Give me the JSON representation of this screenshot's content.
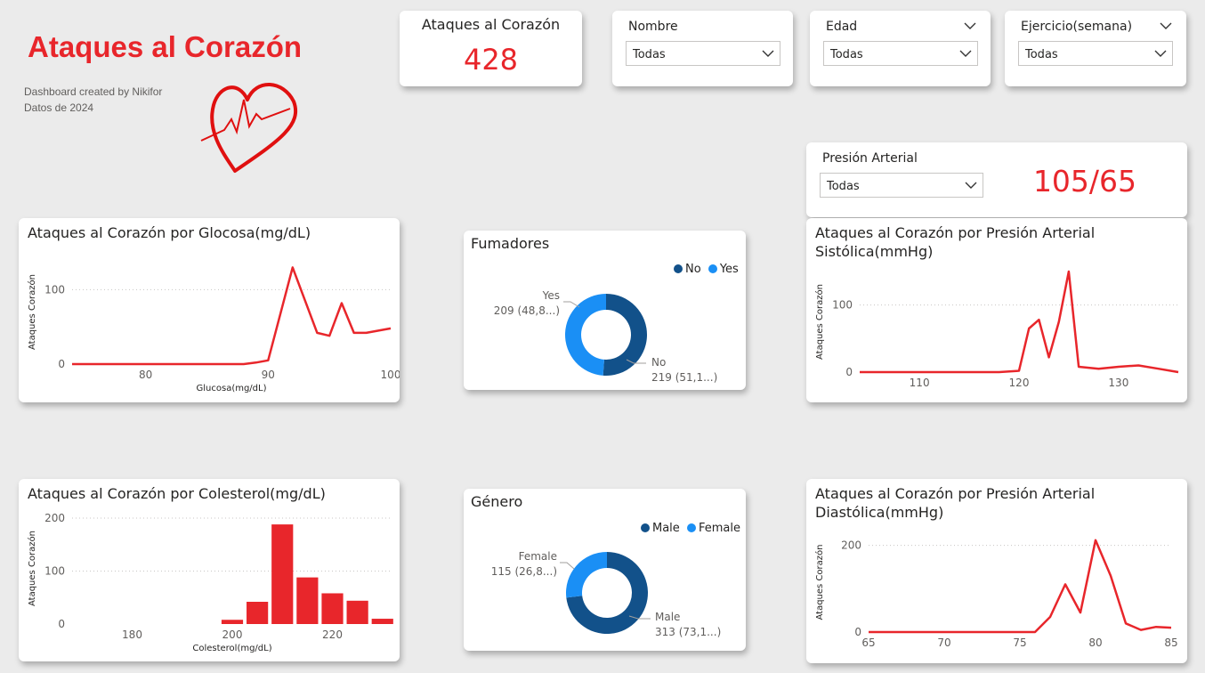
{
  "header": {
    "title": "Ataques al Corazón",
    "credit": "Dashboard created by Nikifor",
    "year": "Datos de 2024"
  },
  "kpi_attacks": {
    "label": "Ataques al Corazón",
    "value": "428"
  },
  "slicers": {
    "nombre": {
      "label": "Nombre",
      "value": "Todas"
    },
    "edad": {
      "label": "Edad",
      "value": "Todas"
    },
    "ejercicio": {
      "label": "Ejercicio(semana)",
      "value": "Todas"
    },
    "presion": {
      "label": "Presión Arterial",
      "value": "Todas"
    }
  },
  "kpi_pressure": {
    "value": "105/65"
  },
  "colors": {
    "accent": "#e8262b",
    "dark_blue": "#12518a",
    "light_blue": "#1a8ff5"
  },
  "chart_data": [
    {
      "id": "glucosa",
      "type": "line",
      "title": "Ataques al Corazón por Glocosa(mg/dL)",
      "xlabel": "Glucosa(mg/dL)",
      "ylabel": "Ataques Corazón",
      "xlim": [
        74,
        100
      ],
      "ylim": [
        0,
        140
      ],
      "xticks": [
        80,
        90,
        100
      ],
      "yticks": [
        0,
        100
      ],
      "x": [
        74,
        76,
        78,
        80,
        82,
        84,
        86,
        88,
        89,
        90,
        92,
        94,
        95,
        96,
        97,
        98,
        100
      ],
      "y": [
        0,
        0,
        0,
        0,
        0,
        0,
        0,
        0,
        2,
        5,
        130,
        42,
        38,
        82,
        42,
        42,
        48
      ]
    },
    {
      "id": "fumadores",
      "type": "pie",
      "title": "Fumadores",
      "labels": [
        "No",
        "Yes"
      ],
      "values": [
        219,
        209
      ],
      "data_labels": [
        "219 (51,1...)",
        "209 (48,8...)"
      ],
      "legend": "top-right"
    },
    {
      "id": "sistolica",
      "type": "line",
      "title": "Ataques al Corazón por Presión Arterial Sistólica(mmHg)",
      "xlabel": "",
      "ylabel": "Ataques Corazón",
      "xlim": [
        104,
        136
      ],
      "ylim": [
        0,
        150
      ],
      "xticks": [
        110,
        120,
        130
      ],
      "yticks": [
        0,
        100
      ],
      "x": [
        104,
        106,
        108,
        110,
        112,
        114,
        116,
        118,
        120,
        121,
        122,
        123,
        124,
        125,
        126,
        128,
        130,
        132,
        134,
        136
      ],
      "y": [
        0,
        0,
        0,
        0,
        0,
        0,
        0,
        0,
        2,
        65,
        78,
        22,
        75,
        150,
        8,
        5,
        8,
        10,
        5,
        0
      ]
    },
    {
      "id": "colesterol",
      "type": "bar",
      "title": "Ataques al Corazón por Colesterol(mg/dL)",
      "xlabel": "Colesterol(mg/dL)",
      "ylabel": "Ataques Corazón",
      "xlim": [
        168,
        232
      ],
      "ylim": [
        0,
        210
      ],
      "xticks": [
        180,
        200,
        220
      ],
      "yticks": [
        0,
        100,
        200
      ],
      "categories": [
        200,
        205,
        210,
        215,
        220,
        225,
        230
      ],
      "values": [
        8,
        42,
        188,
        88,
        58,
        44,
        10
      ]
    },
    {
      "id": "genero",
      "type": "pie",
      "title": "Género",
      "labels": [
        "Male",
        "Female"
      ],
      "values": [
        313,
        115
      ],
      "data_labels": [
        "313 (73,1...)",
        "115 (26,8...)"
      ],
      "legend": "top-right"
    },
    {
      "id": "diastolica",
      "type": "line",
      "title": "Ataques al Corazón por Presión Arterial Diastólica(mmHg)",
      "xlabel": "",
      "ylabel": "Ataques Corazón",
      "xlim": [
        65,
        85
      ],
      "ylim": [
        0,
        230
      ],
      "xticks": [
        65,
        70,
        75,
        80,
        85
      ],
      "yticks": [
        0,
        200
      ],
      "x": [
        65,
        66,
        68,
        70,
        72,
        74,
        75,
        76,
        77,
        78,
        79,
        80,
        81,
        82,
        83,
        84,
        85
      ],
      "y": [
        0,
        0,
        0,
        0,
        0,
        0,
        0,
        0,
        35,
        110,
        45,
        212,
        130,
        20,
        5,
        12,
        10
      ]
    }
  ]
}
